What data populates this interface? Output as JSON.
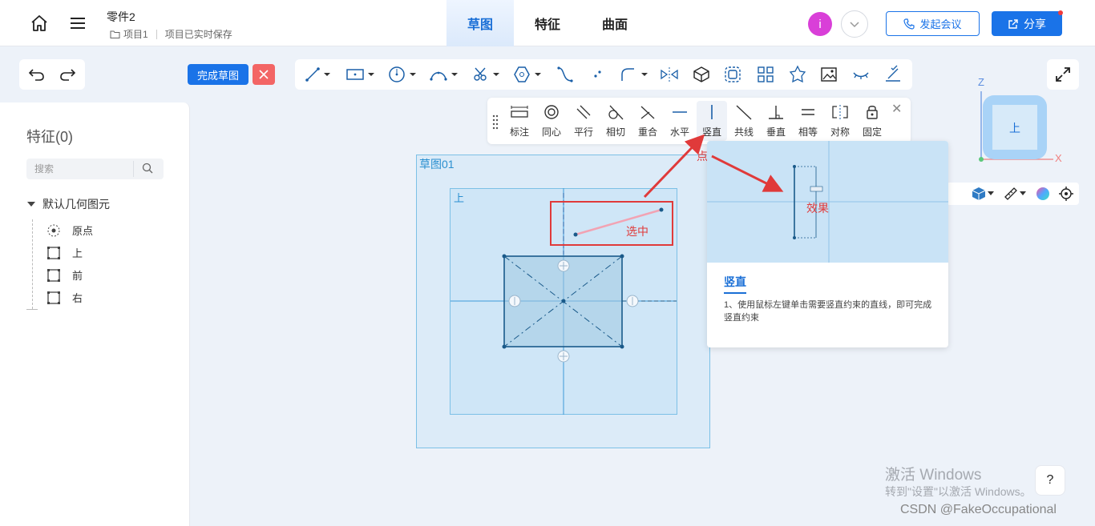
{
  "header": {
    "doc_title": "零件2",
    "project": "项目1",
    "save_status": "项目已实时保存",
    "tabs": [
      {
        "label": "草图",
        "active": true
      },
      {
        "label": "特征",
        "active": false
      },
      {
        "label": "曲面",
        "active": false
      }
    ],
    "avatar_letter": "i",
    "meeting_label": "发起会议",
    "share_label": "分享"
  },
  "toolbar": {
    "finish_label": "完成草图"
  },
  "constraints": [
    {
      "label": "标注",
      "icon": "dimension-icon"
    },
    {
      "label": "同心",
      "icon": "concentric-icon"
    },
    {
      "label": "平行",
      "icon": "parallel-icon"
    },
    {
      "label": "相切",
      "icon": "tangent-icon"
    },
    {
      "label": "重合",
      "icon": "coincident-icon"
    },
    {
      "label": "水平",
      "icon": "horizontal-icon"
    },
    {
      "label": "竖直",
      "icon": "vertical-icon",
      "active": true
    },
    {
      "label": "共线",
      "icon": "collinear-icon"
    },
    {
      "label": "垂直",
      "icon": "perpendicular-icon"
    },
    {
      "label": "相等",
      "icon": "equal-icon"
    },
    {
      "label": "对称",
      "icon": "symmetric-icon"
    },
    {
      "label": "固定",
      "icon": "fix-icon"
    }
  ],
  "sidebar": {
    "title": "特征(0)",
    "search_placeholder": "搜索",
    "tree_root": "默认几何图元",
    "items": [
      {
        "label": "原点",
        "icon": "origin-icon"
      },
      {
        "label": "上",
        "icon": "plane-icon"
      },
      {
        "label": "前",
        "icon": "plane-icon"
      },
      {
        "label": "右",
        "icon": "plane-icon"
      }
    ]
  },
  "canvas": {
    "sketch_label": "草图01",
    "plane_label": "上",
    "annotation_selected": "选中",
    "annotation_click": "点击",
    "annotation_effect": "效果"
  },
  "tooltip": {
    "title": "竖直",
    "description": "1、使用鼠标左键单击需要竖直约束的直线，即可完成竖直约束"
  },
  "view_cube": {
    "face_label": "上",
    "axis_z": "Z",
    "axis_x": "X"
  },
  "watermark": {
    "line1": "激活 Windows",
    "line2": "转到\"设置\"以激活 Windows。",
    "credit": "CSDN @FakeOccupational"
  },
  "help_label": "?",
  "colors": {
    "primary": "#1a73e8",
    "danger": "#f36565",
    "annotation_red": "#e03a3a"
  }
}
